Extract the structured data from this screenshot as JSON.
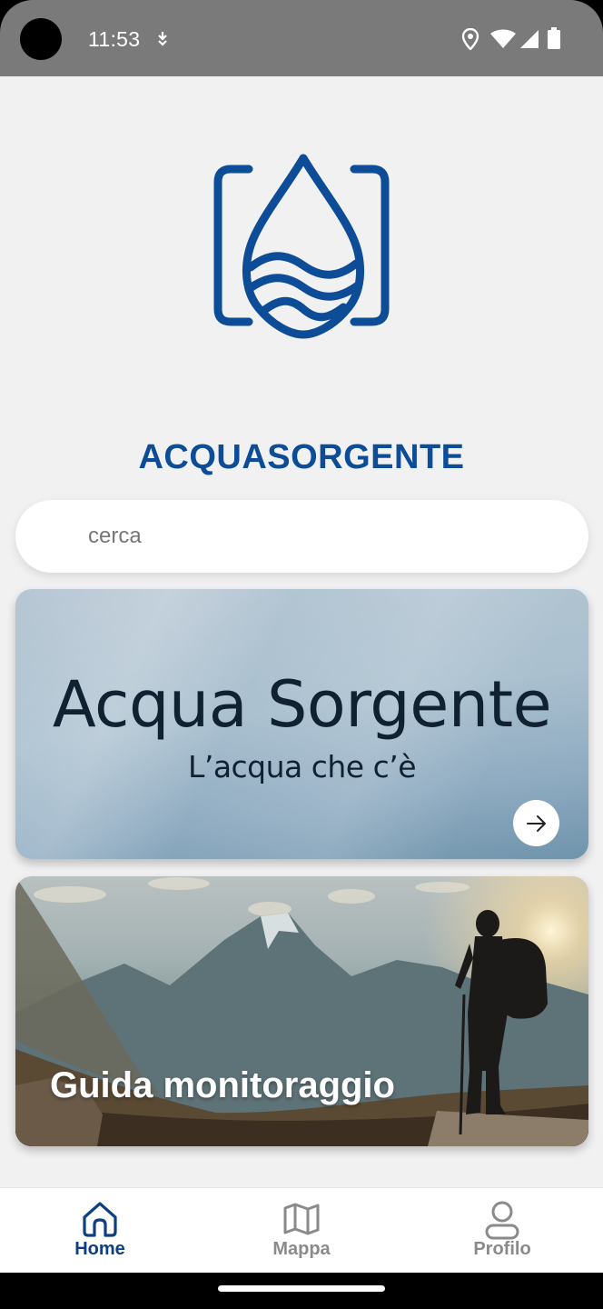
{
  "status_bar": {
    "time": "11:53",
    "icons": [
      "download-icon",
      "location-icon",
      "wifi-icon",
      "signal-icon",
      "battery-icon"
    ]
  },
  "app": {
    "logo": "water-drop-camera-logo",
    "title": "ACQUASORGENTE",
    "brand_color": "#0d4c97"
  },
  "search": {
    "placeholder": "cerca",
    "value": ""
  },
  "cards": [
    {
      "title": "Acqua Sorgente",
      "subtitle": "L’acqua che c’è",
      "action_icon": "arrow-right-icon"
    },
    {
      "title": "Guida monitoraggio",
      "image": "hiker-mountains-image"
    }
  ],
  "nav": {
    "items": [
      {
        "label": "Home",
        "icon": "home-icon",
        "active": true
      },
      {
        "label": "Mappa",
        "icon": "map-icon",
        "active": false
      },
      {
        "label": "Profilo",
        "icon": "profile-icon",
        "active": false
      }
    ],
    "active_color": "#0d3f82",
    "inactive_color": "#8a8a8a"
  }
}
